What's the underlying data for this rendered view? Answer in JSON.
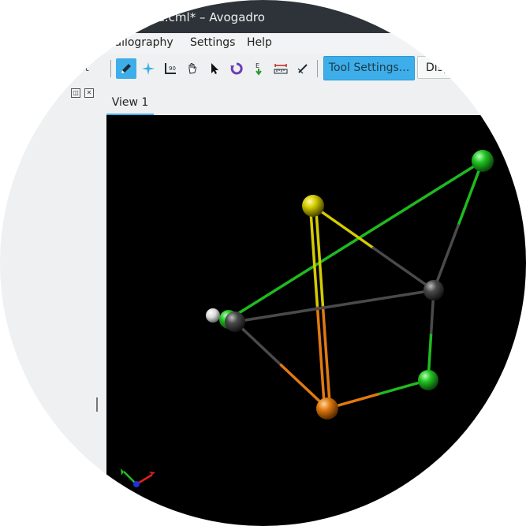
{
  "window": {
    "title": "ked.cml* – Avogadro"
  },
  "menu": {
    "items": [
      {
        "label": "tallography",
        "accel": ""
      },
      {
        "label": "Settings",
        "accel": "S"
      },
      {
        "label": "Help",
        "accel": "H"
      }
    ]
  },
  "toolbar": {
    "edge_label": "it",
    "tool_settings_label": "Tool Settings...",
    "display_label": "Disp",
    "tools": [
      {
        "icon": "pencil-draw-icon",
        "active": true
      },
      {
        "icon": "navigate-star-icon",
        "active": false
      },
      {
        "icon": "measure-angle-icon",
        "active": false
      },
      {
        "icon": "manipulate-hand-icon",
        "active": false
      },
      {
        "icon": "select-arrow-icon",
        "active": false
      },
      {
        "icon": "auto-rotate-icon",
        "active": false
      },
      {
        "icon": "optimize-e-icon",
        "active": false
      },
      {
        "icon": "ruler-measure-icon",
        "active": false
      },
      {
        "icon": "align-tool-icon",
        "active": false
      }
    ]
  },
  "tabs": [
    {
      "label": "View 1",
      "active": true
    }
  ],
  "colors": {
    "accent": "#3daee9",
    "titlebar": "#2d3338",
    "carbon": "#4a4a4a",
    "chlorine": "#1fba1f",
    "sulfur": "#d4cc00",
    "copper": "#e07a10",
    "hydrogen": "#e8e8e8"
  },
  "molecule": {
    "atoms": [
      {
        "id": "Cl1",
        "element": "Cl",
        "color": "#1fba1f"
      },
      {
        "id": "S1",
        "element": "S",
        "color": "#d4cc00"
      },
      {
        "id": "C1",
        "element": "C",
        "color": "#4a4a4a"
      },
      {
        "id": "C2",
        "element": "C",
        "color": "#4a4a4a"
      },
      {
        "id": "H1",
        "element": "H",
        "color": "#e8e8e8"
      },
      {
        "id": "Cl2",
        "element": "Cl",
        "color": "#1fba1f"
      },
      {
        "id": "Cl3",
        "element": "Cl",
        "color": "#1fba1f"
      },
      {
        "id": "Cu1",
        "element": "Cu",
        "color": "#e07a10"
      }
    ],
    "bonds": [
      {
        "a": "Cl1",
        "b": "Cl3",
        "order": 1
      },
      {
        "a": "Cl1",
        "b": "C1",
        "order": 1
      },
      {
        "a": "S1",
        "b": "C1",
        "order": 1
      },
      {
        "a": "S1",
        "b": "Cu1",
        "order": 2
      },
      {
        "a": "C1",
        "b": "C2",
        "order": 1
      },
      {
        "a": "C1",
        "b": "Cl2",
        "order": 1
      },
      {
        "a": "C2",
        "b": "Cu1",
        "order": 1
      },
      {
        "a": "C2",
        "b": "H1",
        "order": 1
      },
      {
        "a": "Cl2",
        "b": "Cu1",
        "order": 1
      }
    ]
  }
}
